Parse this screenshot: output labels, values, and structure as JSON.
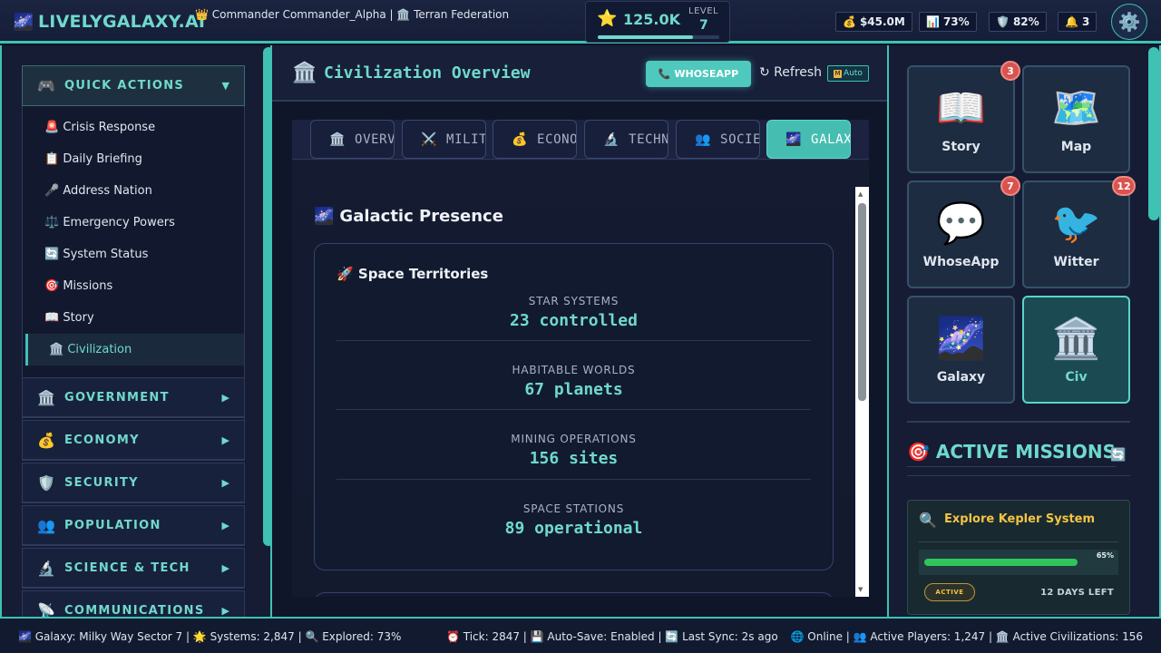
{
  "topbar": {
    "logo_icon": "🌌",
    "logo_text": "LIVELYGALAXY.AI",
    "commander": "👑 Commander Commander_Alpha | 🏛️ Terran Federation",
    "score_icon": "⭐",
    "score": "125.0K",
    "level_label": "LEVEL",
    "level": "7",
    "xp_progress": 0.78,
    "stats": [
      {
        "icon": "💰",
        "value": "$45.0M"
      },
      {
        "icon": "📊",
        "value": "73%"
      },
      {
        "icon": "🛡️",
        "value": "82%"
      },
      {
        "icon": "🔔",
        "value": "3"
      }
    ],
    "settings_icon": "⚙️"
  },
  "sidebar": {
    "quick_actions": {
      "icon": "🎮",
      "label": "QUICK ACTIONS",
      "arrow": "▼"
    },
    "items": [
      {
        "label": "🚨 Crisis Response"
      },
      {
        "label": "📋 Daily Briefing"
      },
      {
        "label": "🎤 Address Nation"
      },
      {
        "label": "⚖️ Emergency Powers"
      },
      {
        "label": "🔄 System Status"
      },
      {
        "label": "🎯 Missions"
      },
      {
        "label": "📖 Story"
      },
      {
        "label": "🏛️ Civilization"
      }
    ],
    "sections": [
      {
        "icon": "🏛️",
        "label": "GOVERNMENT",
        "arrow": "▶"
      },
      {
        "icon": "💰",
        "label": "ECONOMY",
        "arrow": "▶"
      },
      {
        "icon": "🛡️",
        "label": "SECURITY",
        "arrow": "▶"
      },
      {
        "icon": "👥",
        "label": "POPULATION",
        "arrow": "▶"
      },
      {
        "icon": "🔬",
        "label": "SCIENCE & TECH",
        "arrow": "▶"
      },
      {
        "icon": "📡",
        "label": "COMMUNICATIONS",
        "arrow": "▶"
      }
    ]
  },
  "main": {
    "header_icon": "🏛️",
    "title": "Civilization Overview",
    "whoseapp_button": "📞 WHOSEAPP",
    "refresh_button": "↻ Refresh",
    "auto_label": "Auto",
    "auto_box": "M",
    "tabs": [
      {
        "icon": "🏛️",
        "label": "OVERVIEW"
      },
      {
        "icon": "⚔️",
        "label": "MILITARY"
      },
      {
        "icon": "💰",
        "label": "ECONOMY"
      },
      {
        "icon": "🔬",
        "label": "TECHNOLOGY"
      },
      {
        "icon": "👥",
        "label": "SOCIETY"
      },
      {
        "icon": "🌌",
        "label": "GALAXY"
      }
    ],
    "section_icon": "🌌",
    "section_title": "Galactic Presence",
    "card": {
      "title": "🚀 Space Territories",
      "stats": [
        {
          "label": "STAR SYSTEMS",
          "value": "23 controlled"
        },
        {
          "label": "HABITABLE WORLDS",
          "value": "67 planets"
        },
        {
          "label": "MINING OPERATIONS",
          "value": "156 sites"
        },
        {
          "label": "SPACE STATIONS",
          "value": "89 operational"
        }
      ]
    }
  },
  "right": {
    "apps": [
      {
        "icon": "📖",
        "label": "Story",
        "badge": "3"
      },
      {
        "icon": "🗺️",
        "label": "Map",
        "badge": ""
      },
      {
        "icon": "💬",
        "label": "WhoseApp",
        "badge": "7"
      },
      {
        "icon": "🐦",
        "label": "Witter",
        "badge": "12"
      },
      {
        "icon": "🌌",
        "label": "Galaxy",
        "badge": ""
      },
      {
        "icon": "🏛️",
        "label": "Civ",
        "badge": ""
      }
    ],
    "missions_title": "🎯 ACTIVE MISSIONS",
    "missions_refresh": "🔄",
    "mission": {
      "icon": "🔍",
      "title": "Explore Kepler System",
      "progress_label": "65%",
      "progress": 0.65,
      "status": "ACTIVE",
      "days_left": "12 DAYS LEFT"
    }
  },
  "footer": {
    "left": "🌌 Galaxy: Milky Way Sector 7 | 🌟 Systems: 2,847 | 🔍 Explored: 73%",
    "middle": "⏰ Tick: 2847 | 💾 Auto-Save: Enabled | 🔄 Last Sync: 2s ago",
    "right": "🌐 Online | 👥 Active Players: 1,247 | 🏛️ Active Civilizations: 156"
  }
}
